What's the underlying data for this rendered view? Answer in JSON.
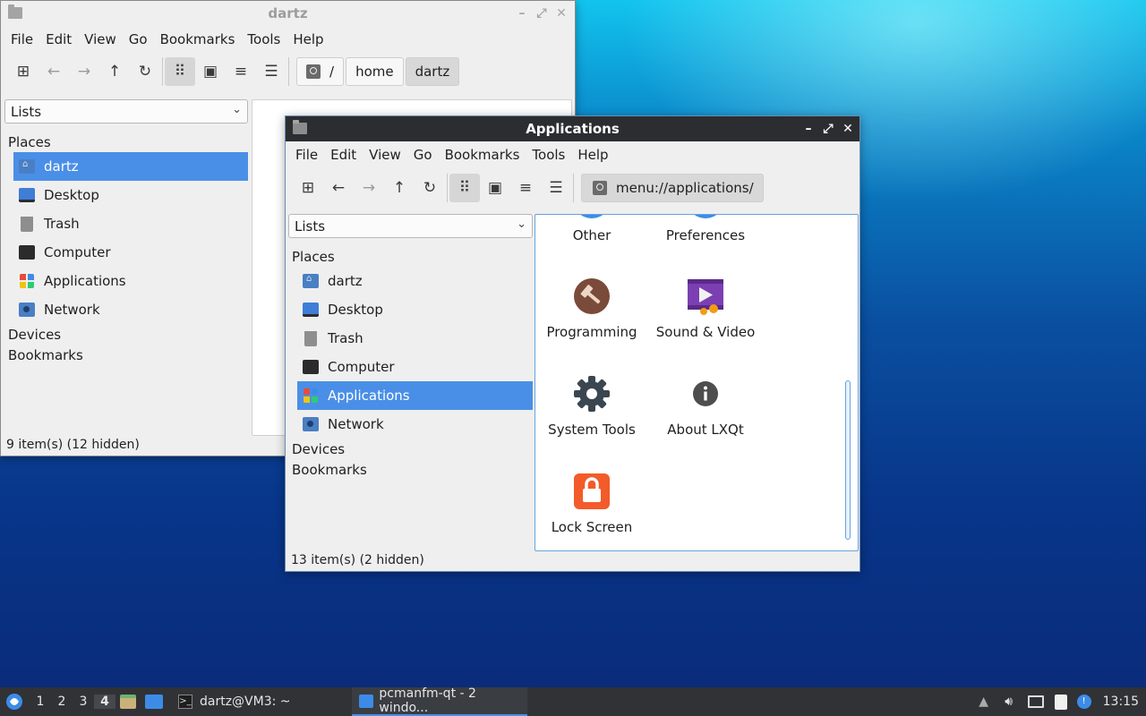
{
  "back_window": {
    "title": "dartz",
    "menu": [
      "File",
      "Edit",
      "View",
      "Go",
      "Bookmarks",
      "Tools",
      "Help"
    ],
    "path": [
      "/",
      "home",
      "dartz"
    ],
    "side_combo": "Lists",
    "places_header": "Places",
    "places": [
      "dartz",
      "Desktop",
      "Trash",
      "Computer",
      "Applications",
      "Network"
    ],
    "devices": "Devices",
    "bookmarks": "Bookmarks",
    "status": "9 item(s) (12 hidden)"
  },
  "front_window": {
    "title": "Applications",
    "menu": [
      "File",
      "Edit",
      "View",
      "Go",
      "Bookmarks",
      "Tools",
      "Help"
    ],
    "location": "menu://applications/",
    "side_combo": "Lists",
    "places_header": "Places",
    "places": [
      "dartz",
      "Desktop",
      "Trash",
      "Computer",
      "Applications",
      "Network"
    ],
    "devices": "Devices",
    "bookmarks": "Bookmarks",
    "items": [
      "Other",
      "Preferences",
      "Programming",
      "Sound & Video",
      "System Tools",
      "About LXQt",
      "Lock Screen"
    ],
    "status": "13 item(s) (2 hidden)"
  },
  "taskbar": {
    "desktops": [
      "1",
      "2",
      "3",
      "4"
    ],
    "tasks": [
      "dartz@VM3: ~",
      "pcmanfm-qt - 2 windo..."
    ],
    "clock": "13:15"
  },
  "colors": {
    "selection": "#4a8fe7",
    "titlebar_active": "#2b2d30",
    "taskbar": "#303236"
  }
}
